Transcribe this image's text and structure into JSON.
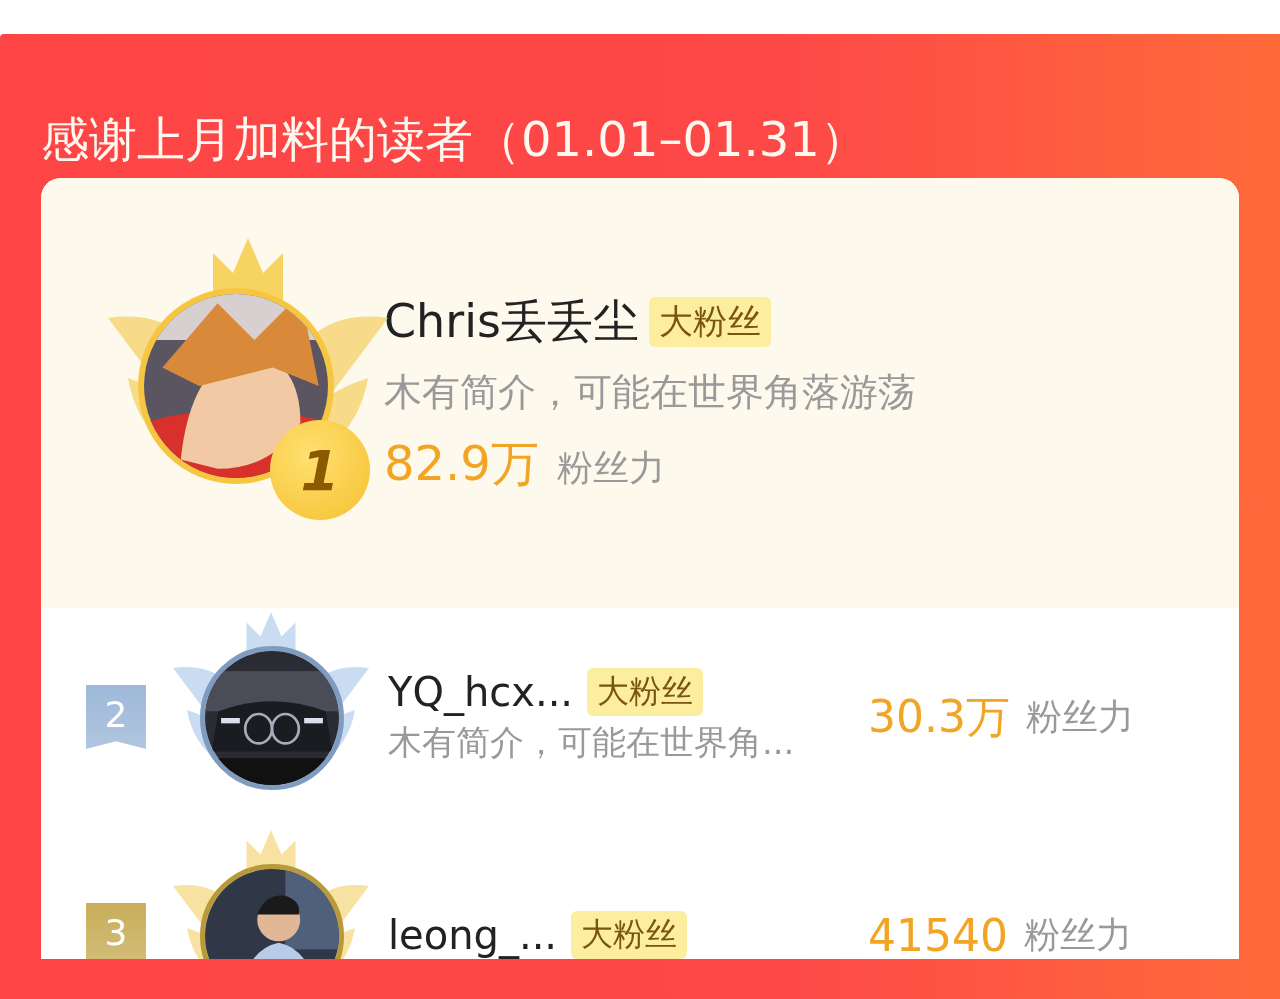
{
  "title": "感谢上月加料的读者（01.01–01.31）",
  "top_fan": {
    "rank": "1",
    "name": "Chris丢丢尘",
    "tag": "大粉丝",
    "intro": "木有简介，可能在世界角落游荡",
    "score": "82.9万",
    "score_unit": "粉丝力"
  },
  "fans": [
    {
      "rank": "2",
      "color": "#9db8d8",
      "name": "YQ_hcx...",
      "tag": "大粉丝",
      "intro": "木有简介，可能在世界角...",
      "score": "30.3万",
      "score_unit": "粉丝力"
    },
    {
      "rank": "3",
      "color": "#c8ae5a",
      "name": "leong_...",
      "tag": "大粉丝",
      "score": "41540",
      "score_unit": "粉丝力"
    }
  ]
}
